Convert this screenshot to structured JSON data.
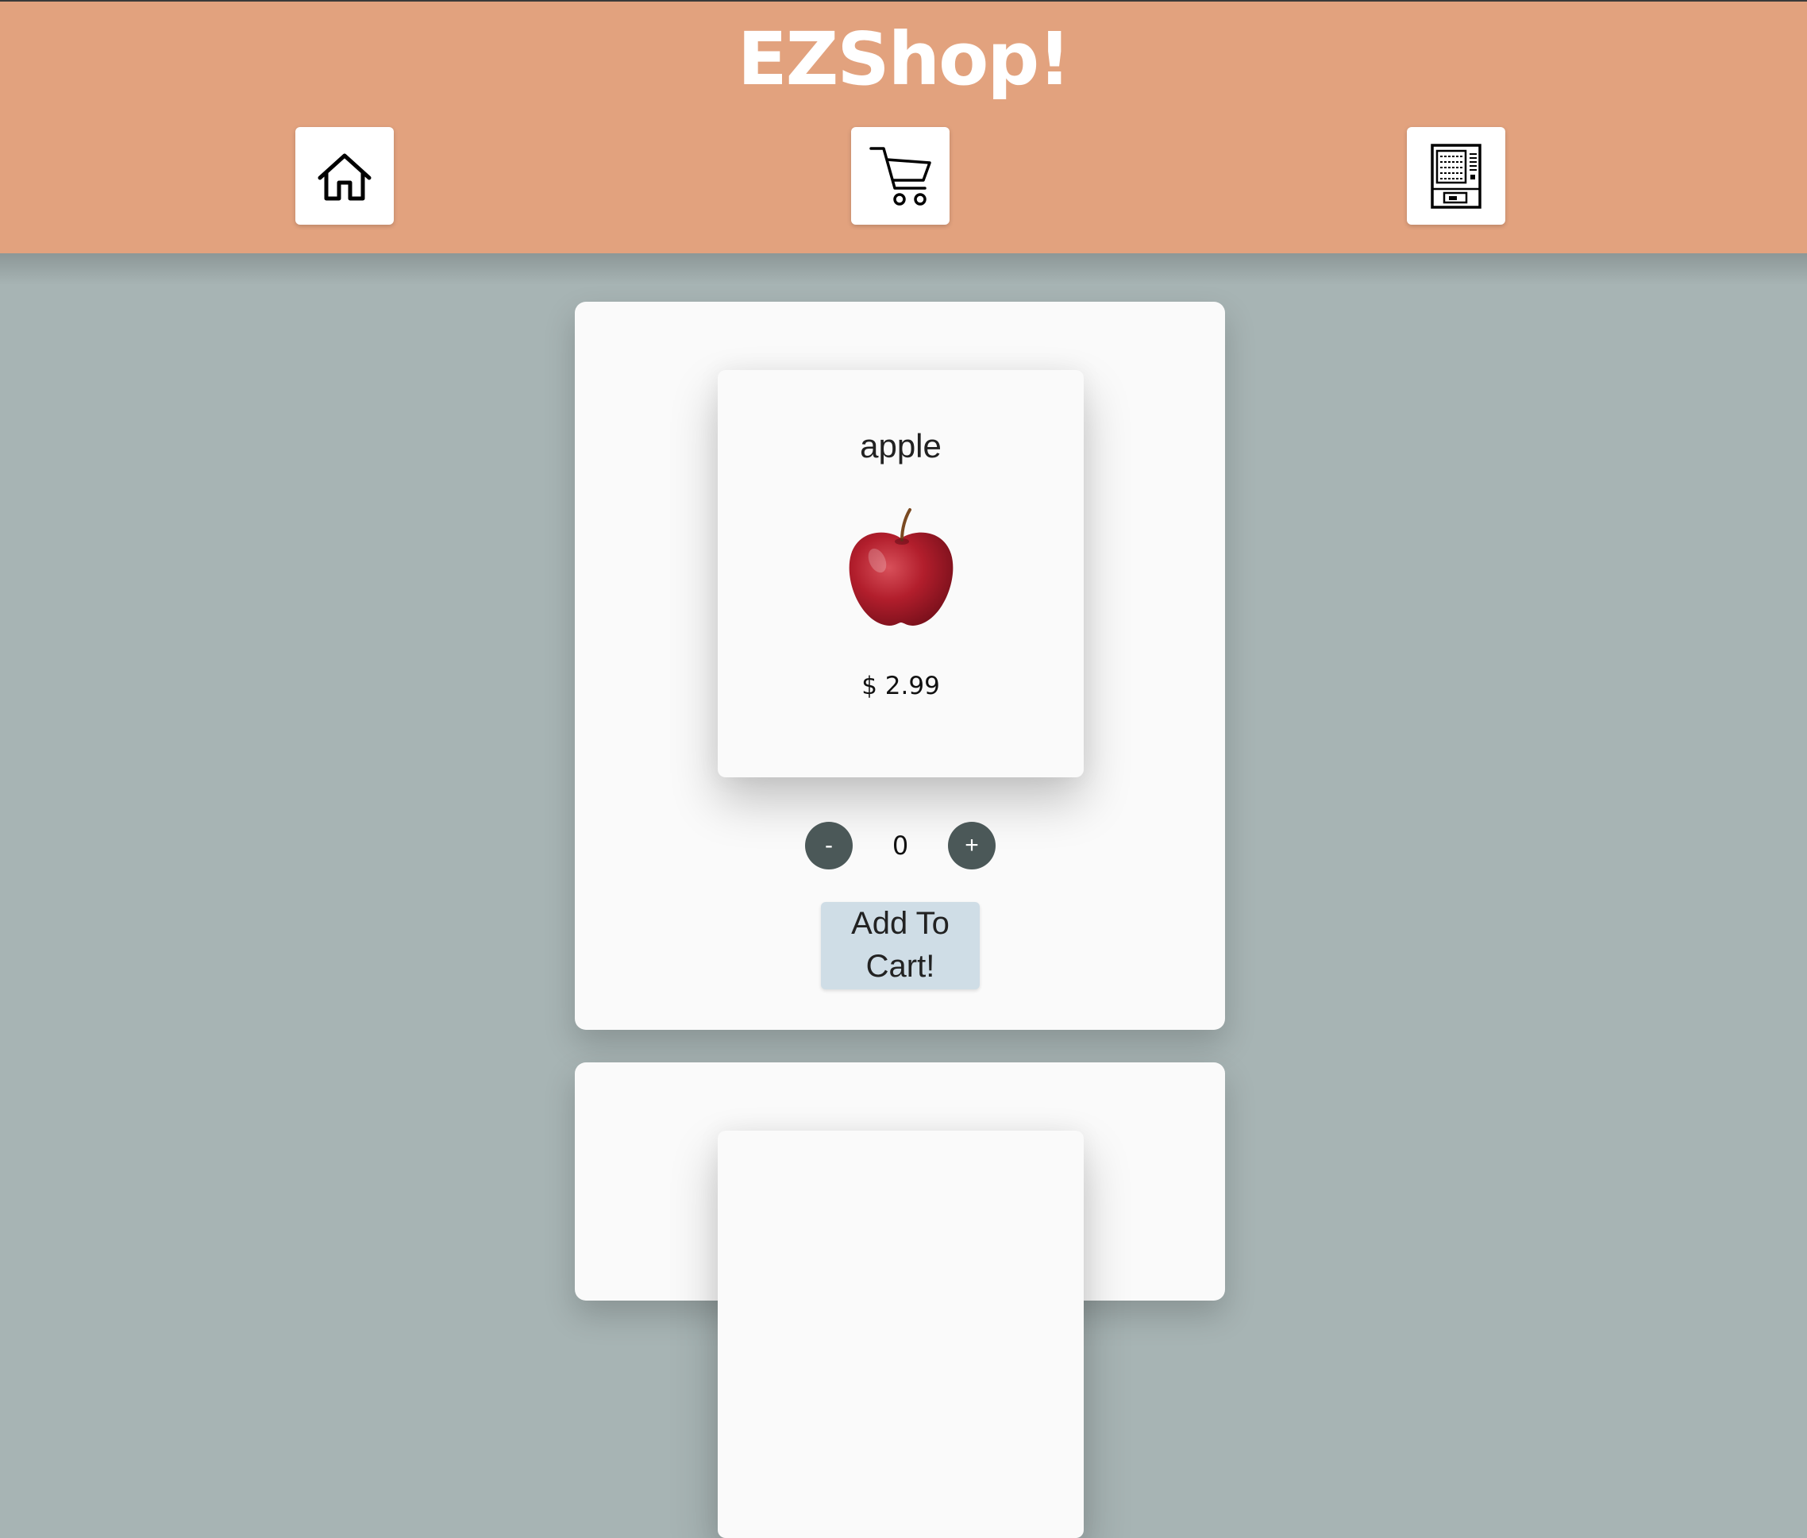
{
  "header": {
    "title": "EZShop!",
    "nav": [
      {
        "name": "home",
        "icon": "home-icon"
      },
      {
        "name": "cart",
        "icon": "shopping-cart-icon"
      },
      {
        "name": "receipt",
        "icon": "vending-machine-icon"
      }
    ],
    "background_color": "#e2a27e"
  },
  "products": [
    {
      "name": "apple",
      "image_icon": "red-apple-image",
      "price": "$ 2.99",
      "quantity": "0",
      "decrement_label": "-",
      "increment_label": "+",
      "add_to_cart_label": "Add To Cart!"
    }
  ],
  "colors": {
    "page_background": "#a7b4b4",
    "card_background": "#fafafa",
    "qty_button": "#4b5858",
    "add_button": "#cfdde6"
  }
}
